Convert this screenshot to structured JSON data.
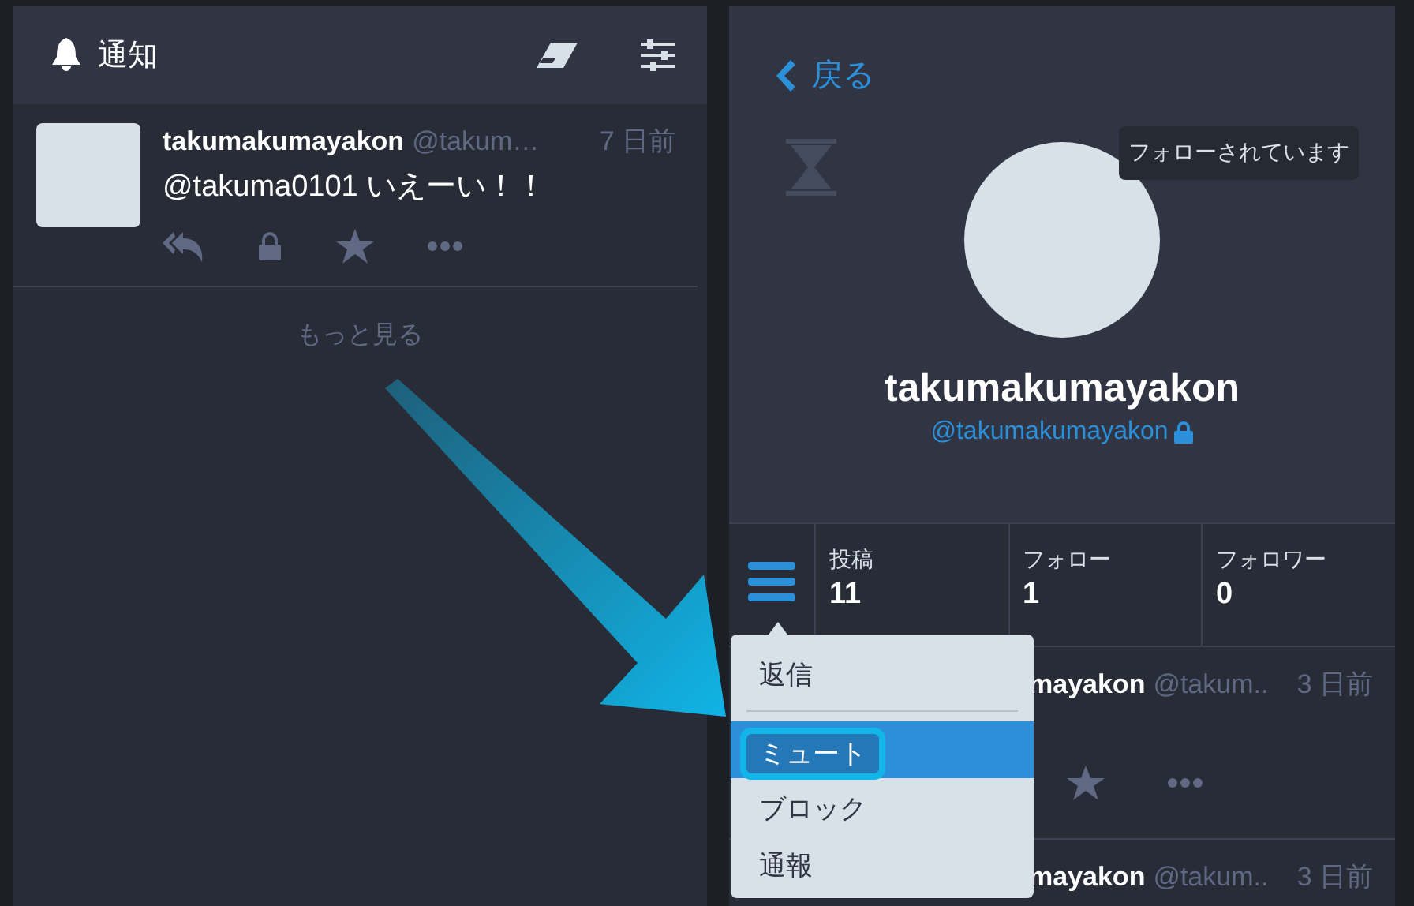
{
  "notifications_column": {
    "title": "通知",
    "posts": [
      {
        "name": "takumakumayakon",
        "handle": "@takum…",
        "time": "7 日前",
        "text": "@takuma0101 いえーい！！"
      }
    ],
    "more_link": "もっと見る"
  },
  "profile_column": {
    "back": "戻る",
    "followed_badge": "フォローされています",
    "name": "takumakumayakon",
    "handle": "@takumakumayakon",
    "locked": true,
    "stats": [
      {
        "label": "投稿",
        "value": "11"
      },
      {
        "label": "フォロー",
        "value": "1"
      },
      {
        "label": "フォロワー",
        "value": "0"
      }
    ],
    "menu": {
      "items": [
        {
          "label": "返信",
          "selected": false,
          "highlighted": false,
          "divider_after": true
        },
        {
          "label": "ミュート",
          "selected": true,
          "highlighted": true,
          "divider_after": false
        },
        {
          "label": "ブロック",
          "selected": false,
          "highlighted": false,
          "divider_after": false
        },
        {
          "label": "通報",
          "selected": false,
          "highlighted": false,
          "divider_after": false
        }
      ]
    },
    "posts": [
      {
        "name": "mayakon",
        "handle": "@takum..",
        "time": "3 日前",
        "actions_visible": true
      },
      {
        "name": "mayakon",
        "handle": "@takum..",
        "time": "3 日前",
        "actions_visible": false
      }
    ]
  }
}
